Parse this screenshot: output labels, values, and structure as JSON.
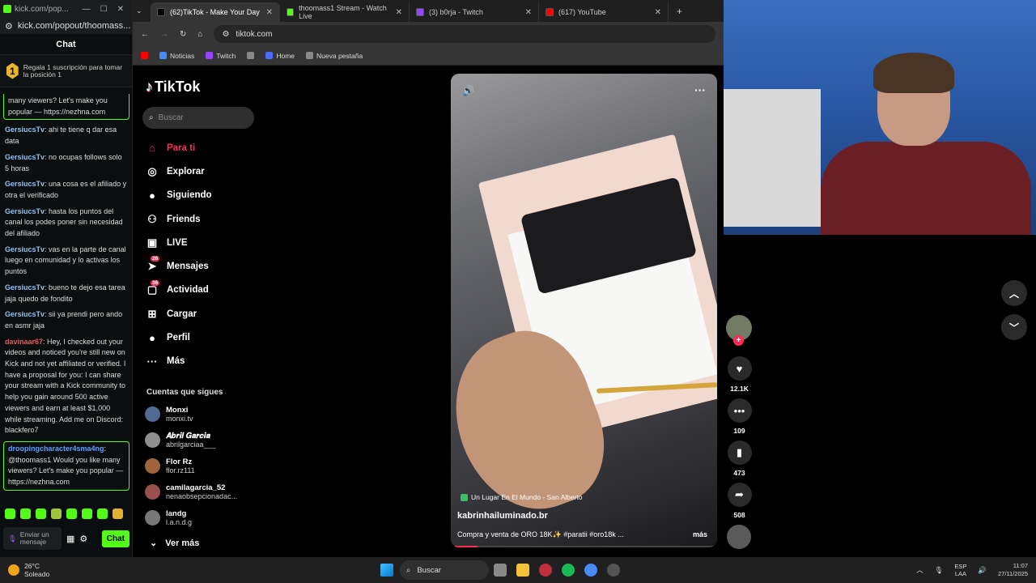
{
  "kick": {
    "window_title": "kick.com/pop...",
    "url": "kick.com/popout/thoomass...",
    "chat_header": "Chat",
    "sub_rank": "1",
    "sub_text": "Regala 1 suscripción para tomar la posición 1",
    "messages": [
      {
        "user": "",
        "text": "many viewers? Let's make you popular — https://nezhna.com",
        "style": "boxed-top"
      },
      {
        "user": "GersiucsTv",
        "text": ": ahi te tiene q dar esa data"
      },
      {
        "user": "GersiucsTv",
        "text": ": no ocupas follows solo 5 horas"
      },
      {
        "user": "GersiucsTv",
        "text": ": una cosa es el afiliado y otra el verificado"
      },
      {
        "user": "GersiucsTv",
        "text": ": hasta los puntos del canal los podes poner sin necesidad del afiliado"
      },
      {
        "user": "GersiucsTv",
        "text": ": vas en la parte de canal luego en comunidad y lo activas los puntos"
      },
      {
        "user": "GersiucsTv",
        "text": ": bueno te dejo esa tarea jaja quedo de fondito"
      },
      {
        "user": "GersiucsTv",
        "text": ": sii ya prendi pero ando en asmr jaja"
      },
      {
        "user": "davinaar67",
        "text": ": Hey, I checked out your videos and noticed you're still new on Kick and not yet affiliated or verified. I have a proposal for you: I can share your stream with a Kick community to help you gain around 500 active viewers and earn at least $1,000 while streaming. Add me on Discord: blackfero7",
        "red": true
      },
      {
        "user": "droopingcharacter4sma4ng",
        "text": ": @thoomass1 Would you like many viewers? Let's make you popular — https://nezhna.com",
        "style": "boxed"
      }
    ],
    "input_placeholder": "Enviar un mensaje",
    "chat_button": "Chat"
  },
  "browser": {
    "tabs": [
      {
        "label": "(62)TikTok - Make Your Day",
        "active": true,
        "color": "#000000"
      },
      {
        "label": "thoomass1 Stream - Watch Live",
        "active": false,
        "color": "#53fc18"
      },
      {
        "label": "(3) b0rja - Twitch",
        "active": false,
        "color": "#9146ff"
      },
      {
        "label": "(617) YouTube",
        "active": false,
        "color": "#ff0000"
      }
    ],
    "url": "tiktok.com",
    "bookmarks": [
      {
        "label": "",
        "color": "#ff0000"
      },
      {
        "label": "Noticias",
        "color": "#4a8af4"
      },
      {
        "label": "Twitch",
        "color": "#9146ff"
      },
      {
        "label": "",
        "color": "#888888"
      },
      {
        "label": "Home",
        "color": "#4a6cf7"
      },
      {
        "label": "Nueva pestaña",
        "color": "#888888"
      }
    ]
  },
  "tiktok": {
    "logo": "TikTok",
    "search_placeholder": "Buscar",
    "nav": [
      {
        "label": "Para ti",
        "icon": "home-icon",
        "active": true
      },
      {
        "label": "Explorar",
        "icon": "compass-icon"
      },
      {
        "label": "Siguiendo",
        "icon": "following-icon"
      },
      {
        "label": "Friends",
        "icon": "friends-icon"
      },
      {
        "label": "LIVE",
        "icon": "live-icon"
      },
      {
        "label": "Mensajes",
        "icon": "messages-icon",
        "count": "26"
      },
      {
        "label": "Actividad",
        "icon": "activity-icon",
        "count": "36"
      },
      {
        "label": "Cargar",
        "icon": "upload-icon"
      },
      {
        "label": "Perfil",
        "icon": "profile-icon"
      },
      {
        "label": "Más",
        "icon": "more-icon"
      }
    ],
    "following_title": "Cuentas que sigues",
    "accounts": [
      {
        "name": "Monxi",
        "handle": "monxi.tv"
      },
      {
        "name": "𝑨𝒃𝒓𝒊𝒍 𝑮𝒂𝒓𝒄𝒊𝒂",
        "handle": "abrilgarciaa___"
      },
      {
        "name": "Flor Rz",
        "handle": "flor.rz111"
      },
      {
        "name": "camilagarcia_52",
        "handle": "nenaobsepcionadac..."
      },
      {
        "name": "landg",
        "handle": "l.a.n.d.g"
      }
    ],
    "see_more": "Ver más",
    "video": {
      "music": "Un Lugar En El Mundo - San Alberto",
      "username": "kabrinhailuminado.br",
      "description": "Compra y venta de ORO 18K✨ #paratii #oro18k ...",
      "more": "más",
      "progress": 0.1
    },
    "actions": {
      "likes": "12.1K",
      "comments": "109",
      "saves": "473",
      "shares": "508"
    }
  },
  "taskbar": {
    "temp": "26°C",
    "weather": "Soleado",
    "search": "Buscar",
    "lang1": "ESP",
    "lang2": "LAA",
    "time": "11:07",
    "date": "27/11/2025"
  }
}
